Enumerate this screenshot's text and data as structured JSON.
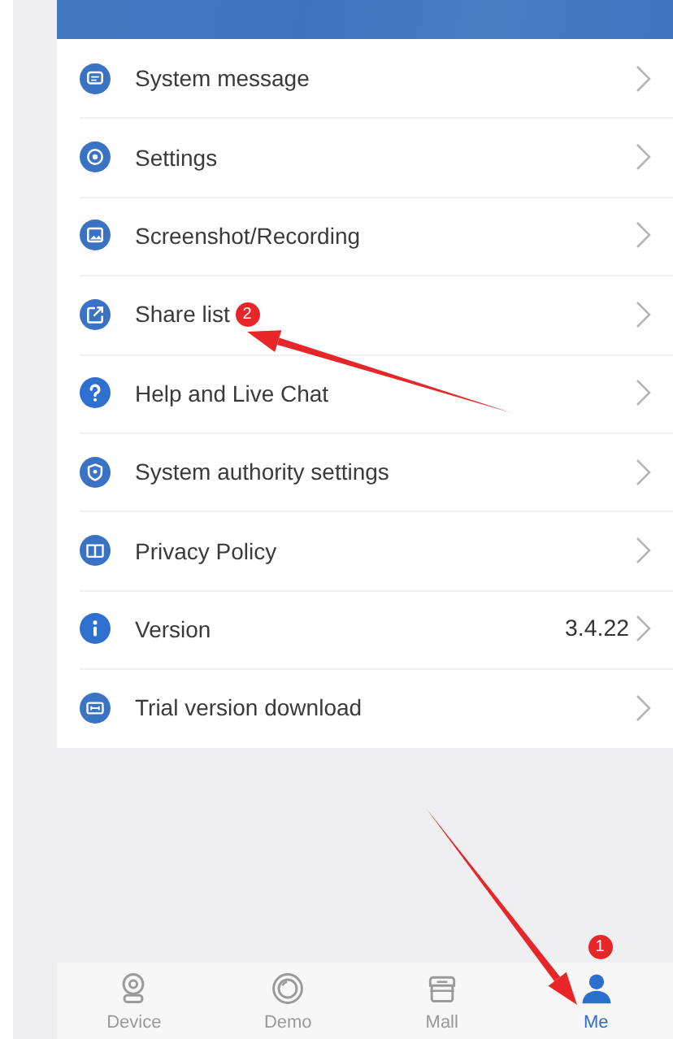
{
  "menu": [
    {
      "label": "System message"
    },
    {
      "label": "Settings"
    },
    {
      "label": "Screenshot/Recording"
    },
    {
      "label": "Share list"
    },
    {
      "label": "Help and Live Chat"
    },
    {
      "label": "System authority settings"
    },
    {
      "label": "Privacy Policy"
    },
    {
      "label": "Version",
      "value": "3.4.22"
    },
    {
      "label": "Trial version download"
    }
  ],
  "tabs": [
    {
      "label": "Device",
      "selected": false
    },
    {
      "label": "Demo",
      "selected": false
    },
    {
      "label": "Mall",
      "selected": false
    },
    {
      "label": "Me",
      "selected": true
    }
  ],
  "annotations": [
    {
      "label": "2"
    },
    {
      "label": "1"
    }
  ]
}
